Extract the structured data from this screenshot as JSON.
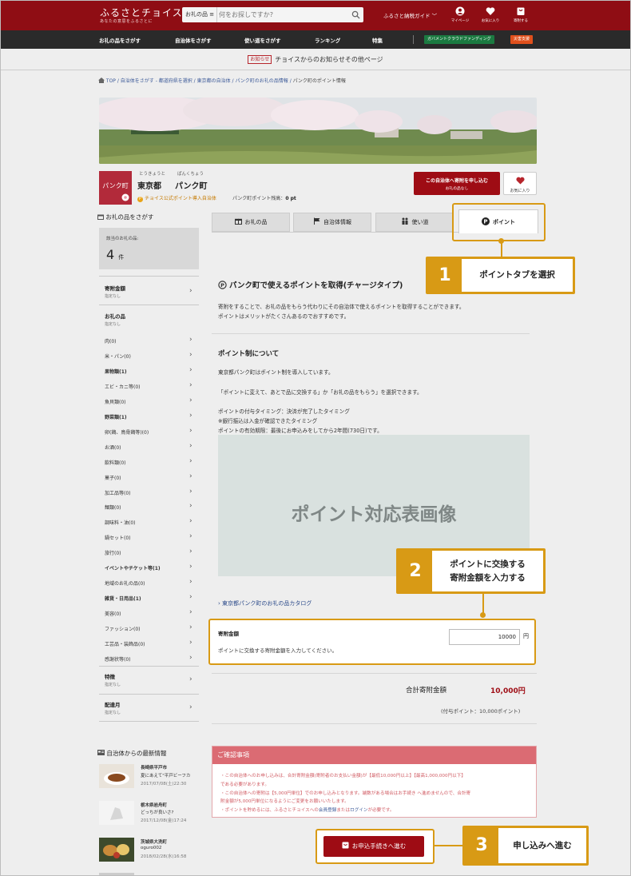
{
  "header": {
    "logo_text": "ふるさとチョイス",
    "logo_sub": "あなたの意思をふるさとに",
    "search_category": "お礼の品 ≡",
    "search_placeholder": "何をお探しですか?",
    "guide_label": "ふるさと納税ガイド ﹀",
    "icons": [
      {
        "label": "マイページ",
        "icon": "user-icon"
      },
      {
        "label": "お気に入り",
        "icon": "heart-icon"
      },
      {
        "label": "寄附する",
        "icon": "gift-bag-icon"
      }
    ]
  },
  "nav": {
    "items": [
      "お礼の品をさがす",
      "自治体をさがす",
      "使い道をさがす",
      "ランキング",
      "特集"
    ],
    "gcf": "ガバメントクラウドファンディング",
    "disaster": "災害支援"
  },
  "notice": {
    "badge": "お知らせ",
    "text": "チョイスからのお知らせその他ページ"
  },
  "breadcrumb": [
    "TOP",
    "自治体をさがす - 都道府県を選択",
    "東京都の自治体",
    "パンク町のお礼の品情報",
    "パンク町のポイント情報"
  ],
  "municipality": {
    "logo_text": "パンク町",
    "pref_kana": "とうきょうと",
    "town_kana": "ぱんくちょう",
    "prefecture": "東京都",
    "town": "パンク町",
    "badge_icon": "P",
    "badge": "チョイス公式ポイント導入自治体",
    "points_label": "パンク町ポイント残高：",
    "points_value": "0 pt",
    "donate_label": "この自治体へ寄附を申し込む",
    "donate_sub": "お礼の品なし",
    "fav_label": "お気に入り"
  },
  "sidebar": {
    "title": "お礼の品をさがす",
    "count_label": "該当のお礼の品:",
    "count": "4",
    "count_unit": "件",
    "amount_title": "寄附金額",
    "amount_sub": "指定なし",
    "gifts_title": "お礼の品",
    "gifts_sub": "指定なし",
    "categories": [
      {
        "label": "肉(0)",
        "bold": false
      },
      {
        "label": "米・パン(0)",
        "bold": false
      },
      {
        "label": "果物類(1)",
        "bold": true
      },
      {
        "label": "エビ・カニ等(0)",
        "bold": false
      },
      {
        "label": "魚貝類(0)",
        "bold": false
      },
      {
        "label": "野菜類(1)",
        "bold": true
      },
      {
        "label": "卵(鶏、鳥骨鶏等)(0)",
        "bold": false
      },
      {
        "label": "お酒(0)",
        "bold": false
      },
      {
        "label": "飲料類(0)",
        "bold": false
      },
      {
        "label": "菓子(0)",
        "bold": false
      },
      {
        "label": "加工品等(0)",
        "bold": false
      },
      {
        "label": "麺類(0)",
        "bold": false
      },
      {
        "label": "調味料・油(0)",
        "bold": false
      },
      {
        "label": "鍋セット(0)",
        "bold": false
      },
      {
        "label": "旅行(0)",
        "bold": false
      },
      {
        "label": "イベントやチケット等(1)",
        "bold": true
      },
      {
        "label": "地域のお礼の品(0)",
        "bold": false
      },
      {
        "label": "雑貨・日用品(1)",
        "bold": true
      },
      {
        "label": "美容(0)",
        "bold": false
      },
      {
        "label": "ファッション(0)",
        "bold": false
      },
      {
        "label": "工芸品・装飾品(0)",
        "bold": false
      },
      {
        "label": "感謝状等(0)",
        "bold": false
      }
    ],
    "feature_title": "特徴",
    "feature_sub": "指定なし",
    "delivery_title": "配達月",
    "delivery_sub": "指定なし"
  },
  "news": {
    "title": "自治体からの最新情報",
    "items": [
      {
        "muni": "長崎県平戸市",
        "title": "夏にあえて\"平戸ビーフカ",
        "date": "2017/07/08(土)22:30"
      },
      {
        "muni": "栃木県岩舟町",
        "title": "どっちが良いさ?",
        "date": "2017/12/08(金)17:24"
      },
      {
        "muni": "茨城県大洗町",
        "title": "oguro002",
        "date": "2018/02/28(水)16:58"
      }
    ]
  },
  "tabs": [
    {
      "label": "お礼の品",
      "icon": "gift-icon"
    },
    {
      "label": "自治体情報",
      "icon": "flag-icon"
    },
    {
      "label": "使い道",
      "icon": "people-icon"
    },
    {
      "label": "ポイント",
      "icon": "point-icon"
    }
  ],
  "callouts": [
    {
      "num": "1",
      "text": "ポイントタブを選択"
    },
    {
      "num": "2",
      "line1": "ポイントに交換する",
      "line2": "寄附金額を入力する"
    },
    {
      "num": "3",
      "text": "申し込みへ進む"
    }
  ],
  "content": {
    "heading": "パンク町で使えるポイントを取得(チャージタイプ)",
    "intro1": "寄附をすることで、お礼の品をもらう代わりにその自治体で使えるポイントを取得することができます。",
    "intro2": "ポイントはメリットがたくさんあるのでおすすめです。",
    "about_title": "ポイント制について",
    "about1": "東京都パンク町はポイント制を導入しています。",
    "about2": "「ポイントに変えて、あとで品に交換する」か「お礼の品をもらう」を選択できます。",
    "timing1": "ポイントの付与タイミング：決済が完了したタイミング",
    "timing2": "※銀行振込は入金が確認できたタイミング",
    "timing3": "ポイントの有効期限：最後にお申込みをしてから2年間(730日)です。",
    "placeholder": "ポイント対応表画像",
    "catalog_link": "› 東京都パンク町のお礼の品カタログ",
    "amount_label": "寄附金額",
    "amount_value": "10000",
    "amount_unit": "円",
    "amount_note": "ポイントに交換する寄附金額を入力してください。",
    "total_label": "合計寄附金額",
    "total_value": "10,000円",
    "total_points": "(付与ポイント：10,000ポイント)"
  },
  "confirm": {
    "title": "ご確認事項",
    "lines": [
      "・この自治体へのお申し込みは、合計寄附金額(寄附者のお支払い金額)が【最低10,000円以上】【最高1,000,000円以下】",
      "である必要があります。",
      "・この自治体への寄附は【5,000円単位】でのお申し込みとなります。端数がある場合はお手続き へ進めませんので、合計寄",
      "附金額が5,000円単位になるようにご変更をお願いいたします。"
    ],
    "last_pre": "・ポイントを貯めるには、ふるさとチョイスへの",
    "link_register": "会員登録",
    "last_mid": "または",
    "link_login": "ログイン",
    "last_post": "が必要です。"
  },
  "apply_button": "お申込手続きへ進む",
  "colors": {
    "brand": "#8f0d14",
    "accent": "#d89a15",
    "button": "#9e0c14"
  }
}
